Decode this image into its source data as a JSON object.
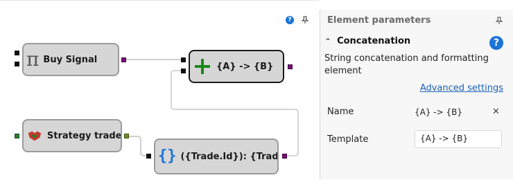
{
  "canvas": {
    "nodes": [
      {
        "id": "buy-signal",
        "label": "Buy Signal",
        "icon": "pi-icon"
      },
      {
        "id": "concat",
        "label": "{A} -> {B}",
        "icon": "plus-icon"
      },
      {
        "id": "strategy-trades",
        "label": "Strategy trades",
        "icon": "handshake-icon"
      },
      {
        "id": "format",
        "label": "({Trade.Id}): {Trade...",
        "icon": "braces-icon"
      }
    ]
  },
  "panel": {
    "title": "Element parameters",
    "section_title": "Concatenation",
    "description": "String concatenation and formatting element",
    "advanced_link": "Advanced settings",
    "fields": {
      "name_label": "Name",
      "name_value": "{A} -> {B}",
      "template_label": "Template",
      "template_value": "{A} -> {B}"
    }
  },
  "colors": {
    "node_fill": "#d6d6d6",
    "port_purple": "#7b0f7b",
    "port_green": "#2f7a2f",
    "help_blue": "#1a73d9",
    "link_blue": "#1a5fb4"
  }
}
